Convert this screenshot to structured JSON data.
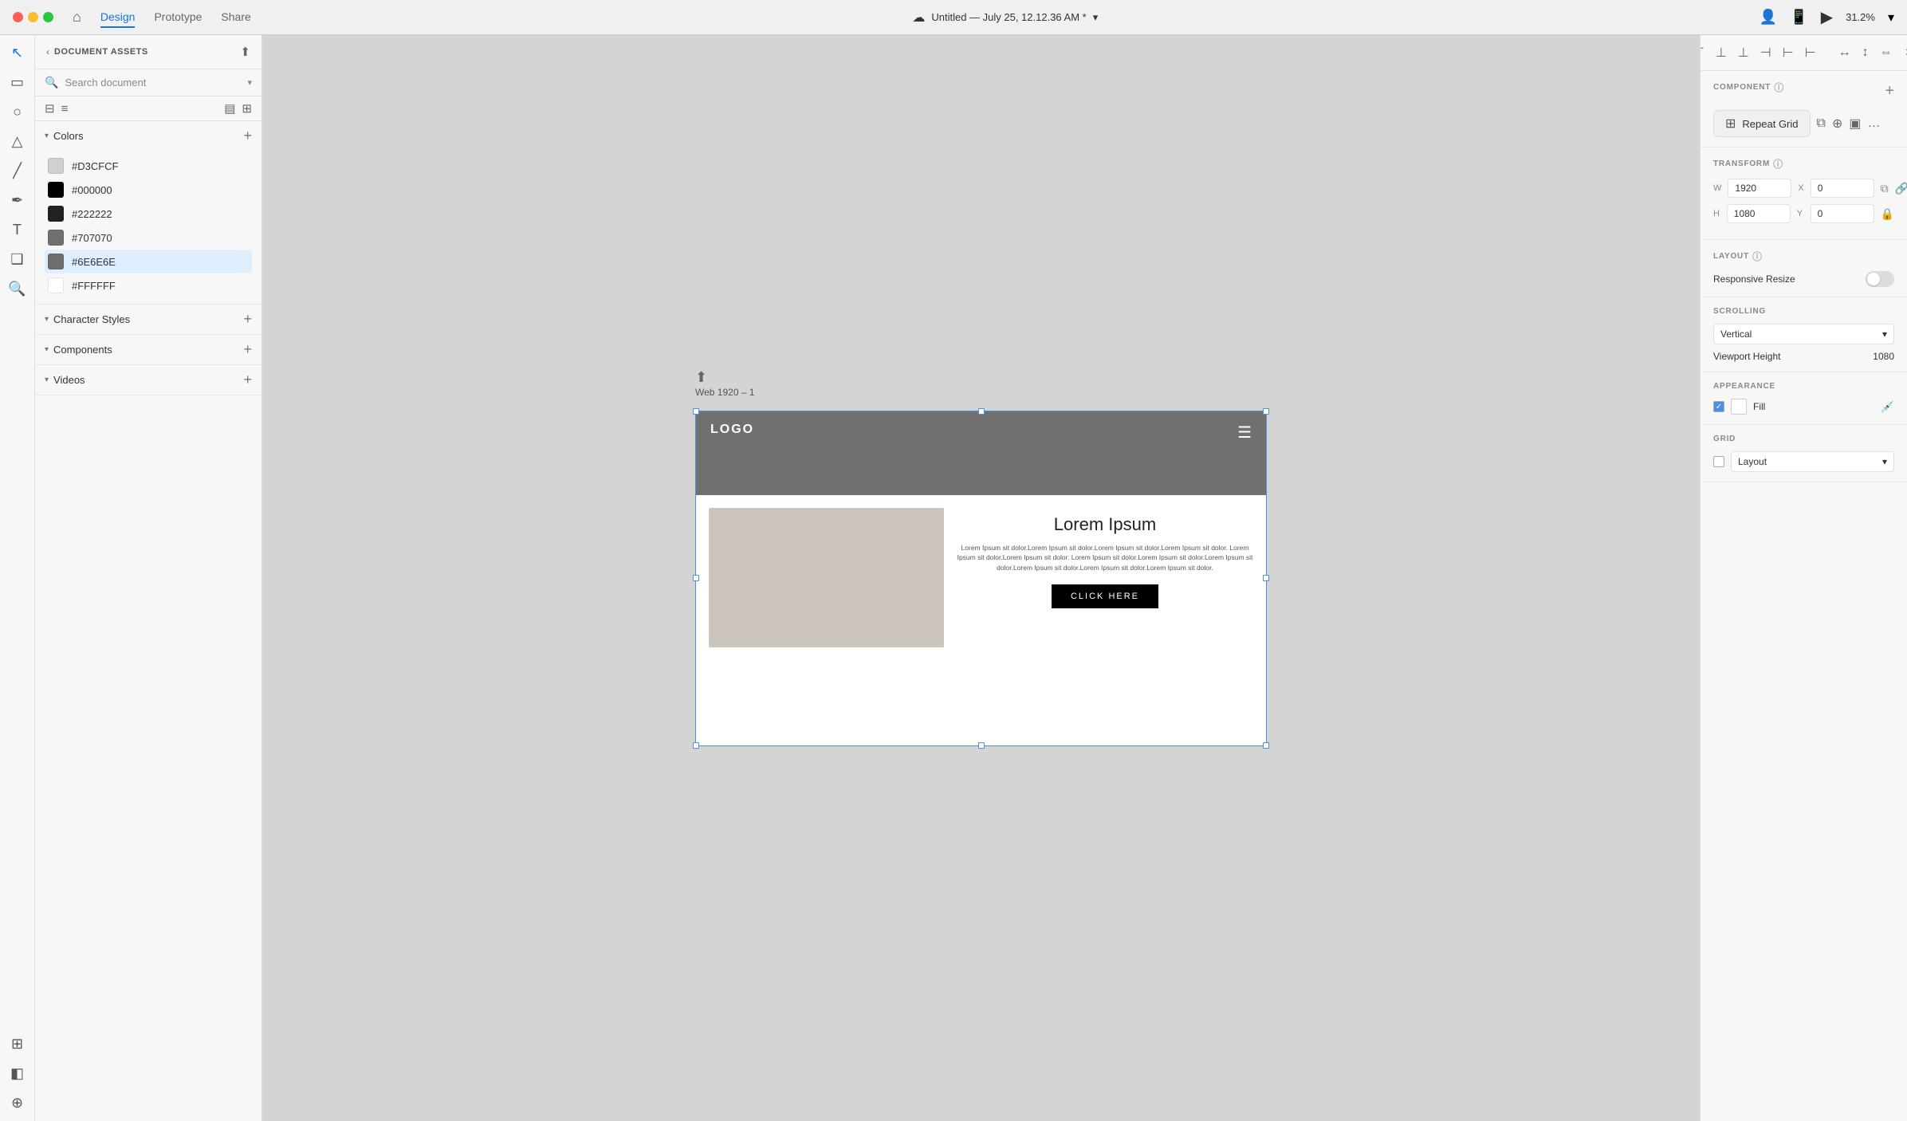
{
  "topbar": {
    "traffic_red": "close",
    "traffic_yellow": "minimize",
    "traffic_green": "maximize",
    "tabs": [
      "Design",
      "Prototype",
      "Share"
    ],
    "active_tab": "Design",
    "title": "Untitled — July 25, 12.12.36 AM *",
    "zoom": "31.2%"
  },
  "left_sidebar": {
    "title": "DOCUMENT ASSETS",
    "search_placeholder": "Search document",
    "sections": {
      "colors": {
        "label": "Colors",
        "items": [
          {
            "hex": "#D3CFCF",
            "label": "#D3CFCF",
            "swatch": "#D3CFCF"
          },
          {
            "hex": "#000000",
            "label": "#000000",
            "swatch": "#000000"
          },
          {
            "hex": "#222222",
            "label": "#222222",
            "swatch": "#222222"
          },
          {
            "hex": "#707070",
            "label": "#707070",
            "swatch": "#707070"
          },
          {
            "hex": "#6E6E6E",
            "label": "#6E6E6E",
            "swatch": "#6E6E6E"
          },
          {
            "hex": "#FFFFFF",
            "label": "#FFFFFF",
            "swatch": "#FFFFFF"
          }
        ]
      },
      "character_styles": {
        "label": "Character Styles"
      },
      "components": {
        "label": "Components"
      },
      "videos": {
        "label": "Videos"
      }
    }
  },
  "canvas": {
    "artboard_label": "Web 1920 – 1",
    "artboard": {
      "header": {
        "logo": "LOGO",
        "bg": "#707070"
      },
      "body": {
        "title": "Lorem Ipsum",
        "text": "Lorem Ipsum sit dolor.Lorem Ipsum sit dolor.Lorem Ipsum sit dolor.Lorem Ipsum sit dolor. Lorem Ipsum sit dolor.Lorem Ipsum sit dolor. Lorem Ipsum sit dolor.Lorem Ipsum sit dolor.Lorem Ipsum sit dolor.Lorem Ipsum sit dolor.Lorem Ipsum sit dolor.Lorem Ipsum sit dolor.",
        "button_label": "CLICK HERE",
        "button_bg": "#000000"
      }
    }
  },
  "right_sidebar": {
    "repeat_grid_label": "Repeat Grid",
    "sections": {
      "component": {
        "title": "COMPONENT"
      },
      "transform": {
        "title": "TRANSFORM",
        "w_label": "W",
        "w_value": "1920",
        "x_label": "X",
        "x_value": "0",
        "h_label": "H",
        "h_value": "1080",
        "y_label": "Y",
        "y_value": "0"
      },
      "layout": {
        "title": "LAYOUT",
        "responsive_resize_label": "Responsive Resize"
      },
      "scrolling": {
        "title": "SCROLLING",
        "direction_label": "Vertical",
        "viewport_height_label": "Viewport Height",
        "viewport_height_value": "1080"
      },
      "appearance": {
        "title": "APPEARANCE",
        "fill_label": "Fill"
      },
      "grid": {
        "title": "GRID",
        "layout_label": "Layout"
      }
    }
  }
}
